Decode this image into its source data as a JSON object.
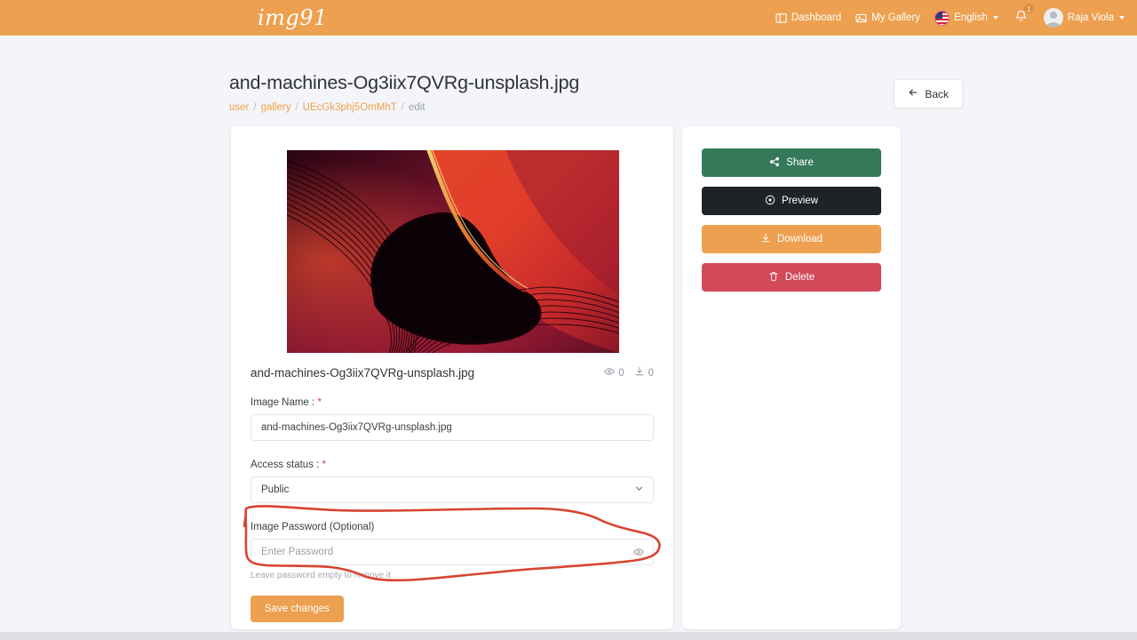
{
  "navbar": {
    "brand": "img91",
    "links": [
      {
        "label": "Dashboard",
        "icon": "dashboard-icon"
      },
      {
        "label": "My Gallery",
        "icon": "gallery-icon"
      }
    ],
    "language": {
      "label": "English",
      "icon": "us-flag-icon"
    },
    "notifications": {
      "count": "1",
      "icon": "bell-icon"
    },
    "user": {
      "name": "Raja Viola",
      "icon": "avatar-icon"
    }
  },
  "header": {
    "title": "and-machines-Og3iix7QVRg-unsplash.jpg",
    "breadcrumb": [
      {
        "label": "user",
        "link": true
      },
      {
        "label": "gallery",
        "link": true
      },
      {
        "label": "UEcGk3phj5OmMhT",
        "link": true
      },
      {
        "label": "edit",
        "link": false
      }
    ],
    "separator": "/",
    "back_label": "Back"
  },
  "detail": {
    "file_name": "and-machines-Og3iix7QVRg-unsplash.jpg",
    "views": "0",
    "downloads": "0"
  },
  "form": {
    "name_label": "Image Name :",
    "name_value": "and-machines-Og3iix7QVRg-unsplash.jpg",
    "access_label": "Access status :",
    "access_value": "Public",
    "password_label": "Image Password (Optional)",
    "password_placeholder": "Enter Password",
    "password_value": "",
    "password_helper": "Leave password empty to remove it",
    "save_label": "Save changes",
    "required_mark": "*"
  },
  "actions": [
    {
      "label": "Share",
      "icon": "share-icon",
      "color": "#34795a"
    },
    {
      "label": "Preview",
      "icon": "eye-icon",
      "color": "#1f2327"
    },
    {
      "label": "Download",
      "icon": "download-icon",
      "color": "#eda04f"
    },
    {
      "label": "Delete",
      "icon": "trash-icon",
      "color": "#d2495a"
    }
  ],
  "colors": {
    "brand_orange": "#eda04f",
    "page_background": "#f4f5f9",
    "annotation_red": "#d7442f",
    "required_red": "#e03c3c",
    "link_orange": "#f0a04b"
  },
  "annotation": {
    "shape": "hand-drawn-lasso-ellipse",
    "target": "image-password-field"
  }
}
